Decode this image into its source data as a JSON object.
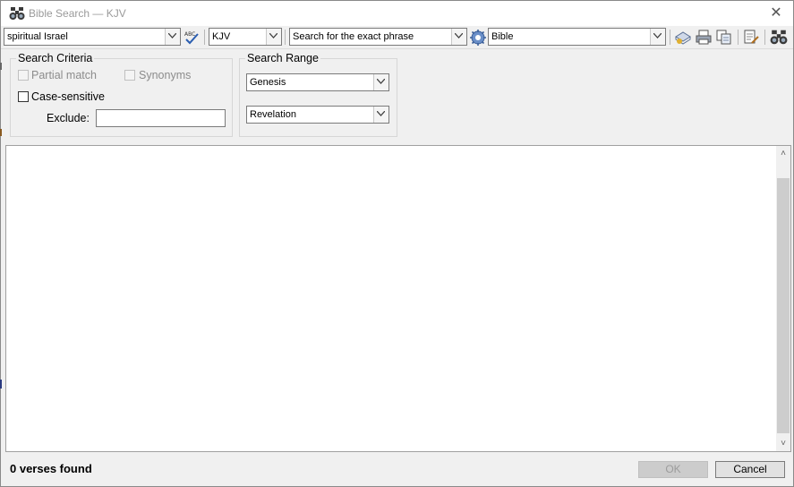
{
  "window": {
    "title": "Bible Search — KJV",
    "close_glyph": "✕"
  },
  "toolbar": {
    "query_value": "spiritual Israel",
    "version_value": "KJV",
    "search_mode_value": "Search for the exact phrase",
    "scope_value": "Bible",
    "icons": [
      "spellcheck-icon",
      "gear-icon",
      "bookmark-icon",
      "print-icon",
      "copy-icon",
      "export-icon",
      "binoculars-icon"
    ]
  },
  "search_criteria": {
    "legend": "Search Criteria",
    "partial_match_label": "Partial match",
    "synonyms_label": "Synonyms",
    "case_sensitive_label": "Case-sensitive",
    "exclude_label": "Exclude:",
    "exclude_value": ""
  },
  "search_range": {
    "legend": "Search Range",
    "from_value": "Genesis",
    "to_value": "Revelation"
  },
  "results": {
    "scroll_up_glyph": "˄",
    "scroll_down_glyph": "˅"
  },
  "footer": {
    "status": "0 verses found",
    "ok_label": "OK",
    "cancel_label": "Cancel"
  }
}
